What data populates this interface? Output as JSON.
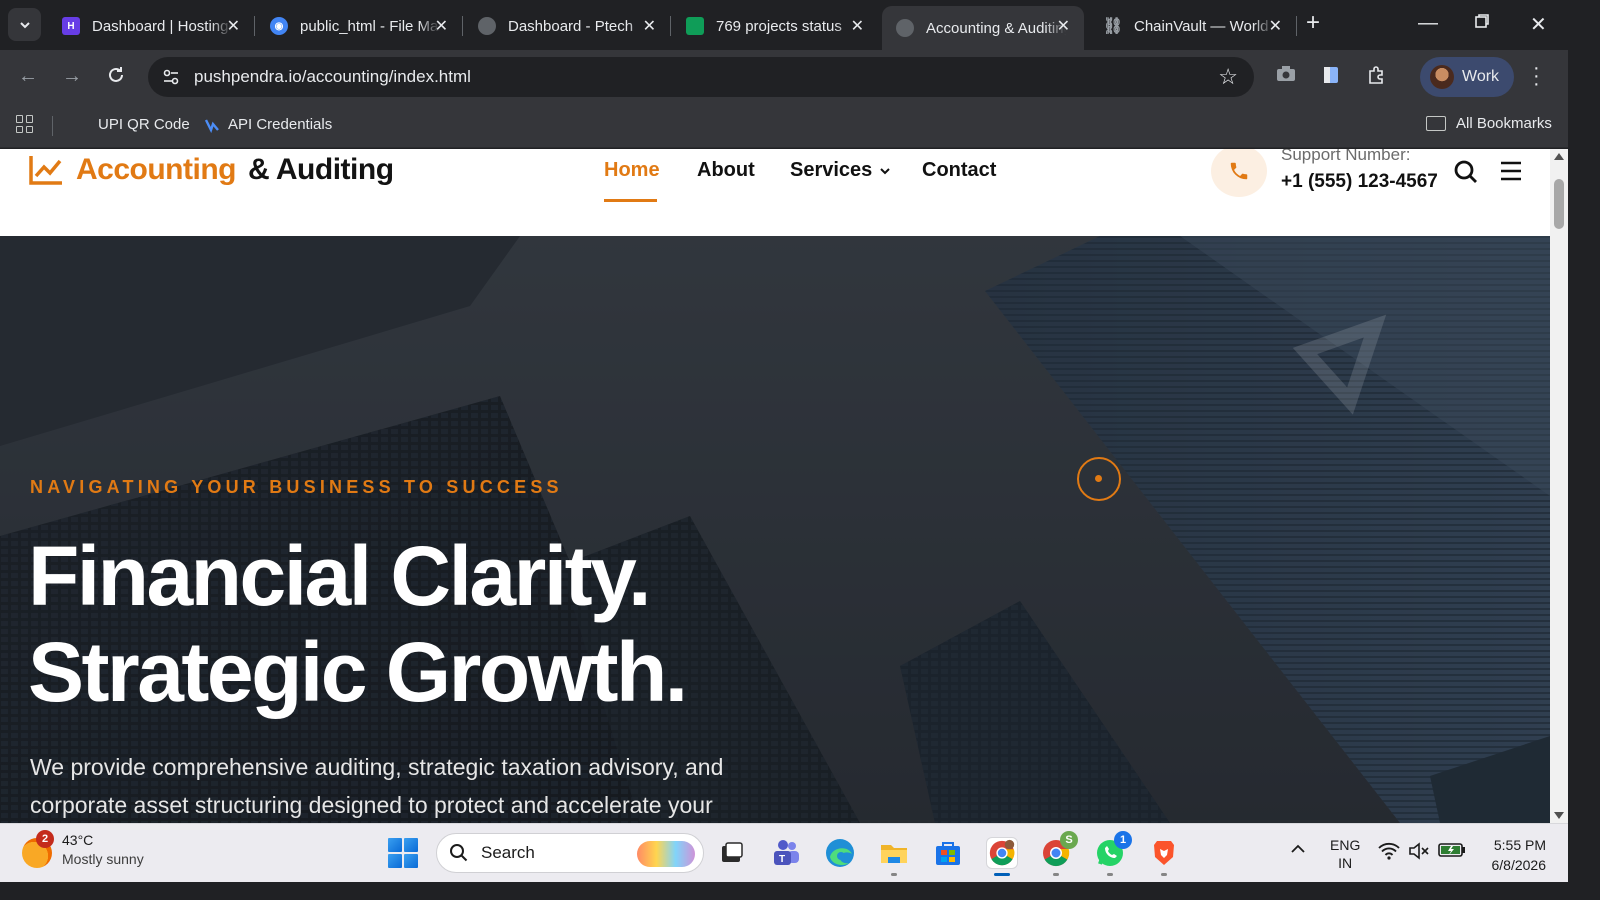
{
  "browser": {
    "tabs": [
      {
        "title": "Dashboard | Hostinger",
        "favicon_color": "#673de6",
        "active": false
      },
      {
        "title": "public_html - File Manager",
        "favicon_color": "#4285f4",
        "active": false
      },
      {
        "title": "Dashboard - Ptech",
        "favicon_color": "#5f6368",
        "active": false
      },
      {
        "title": "769 projects status",
        "favicon_color": "#0f9d58",
        "active": false
      },
      {
        "title": "Accounting & Auditing",
        "favicon_color": "#5f6368",
        "active": true
      },
      {
        "title": "ChainVault — World",
        "favicon_color": "#9aa0a6",
        "active": false
      }
    ],
    "url": "pushpendra.io/accounting/index.html",
    "profile_label": "Work",
    "bookmarks": [
      {
        "label": "UPI QR Code"
      },
      {
        "label": "API Credentials"
      }
    ],
    "all_bookmarks_label": "All Bookmarks"
  },
  "site": {
    "logo": {
      "part1": "Accounting",
      "part2": "& Auditing",
      "accent_color": "#e17a14"
    },
    "nav": {
      "home": "Home",
      "about": "About",
      "services": "Services",
      "contact": "Contact"
    },
    "support": {
      "label": "Support Number:",
      "number": "+1 (555) 123-4567"
    },
    "hero": {
      "eyebrow": "NAVIGATING YOUR BUSINESS TO SUCCESS",
      "title_line1": "Financial Clarity.",
      "title_line2": "Strategic Growth.",
      "description": "We provide comprehensive auditing, strategic taxation advisory, and corporate asset structuring designed to protect and accelerate your"
    }
  },
  "taskbar": {
    "weather": {
      "temp": "43°C",
      "condition": "Mostly sunny",
      "badge": "2"
    },
    "search_placeholder": "Search",
    "lang_line1": "ENG",
    "lang_line2": "IN",
    "time": "5:55 PM",
    "date": "6/8/2026",
    "whatsapp_badge": "1",
    "chrome2_badge": "S"
  }
}
